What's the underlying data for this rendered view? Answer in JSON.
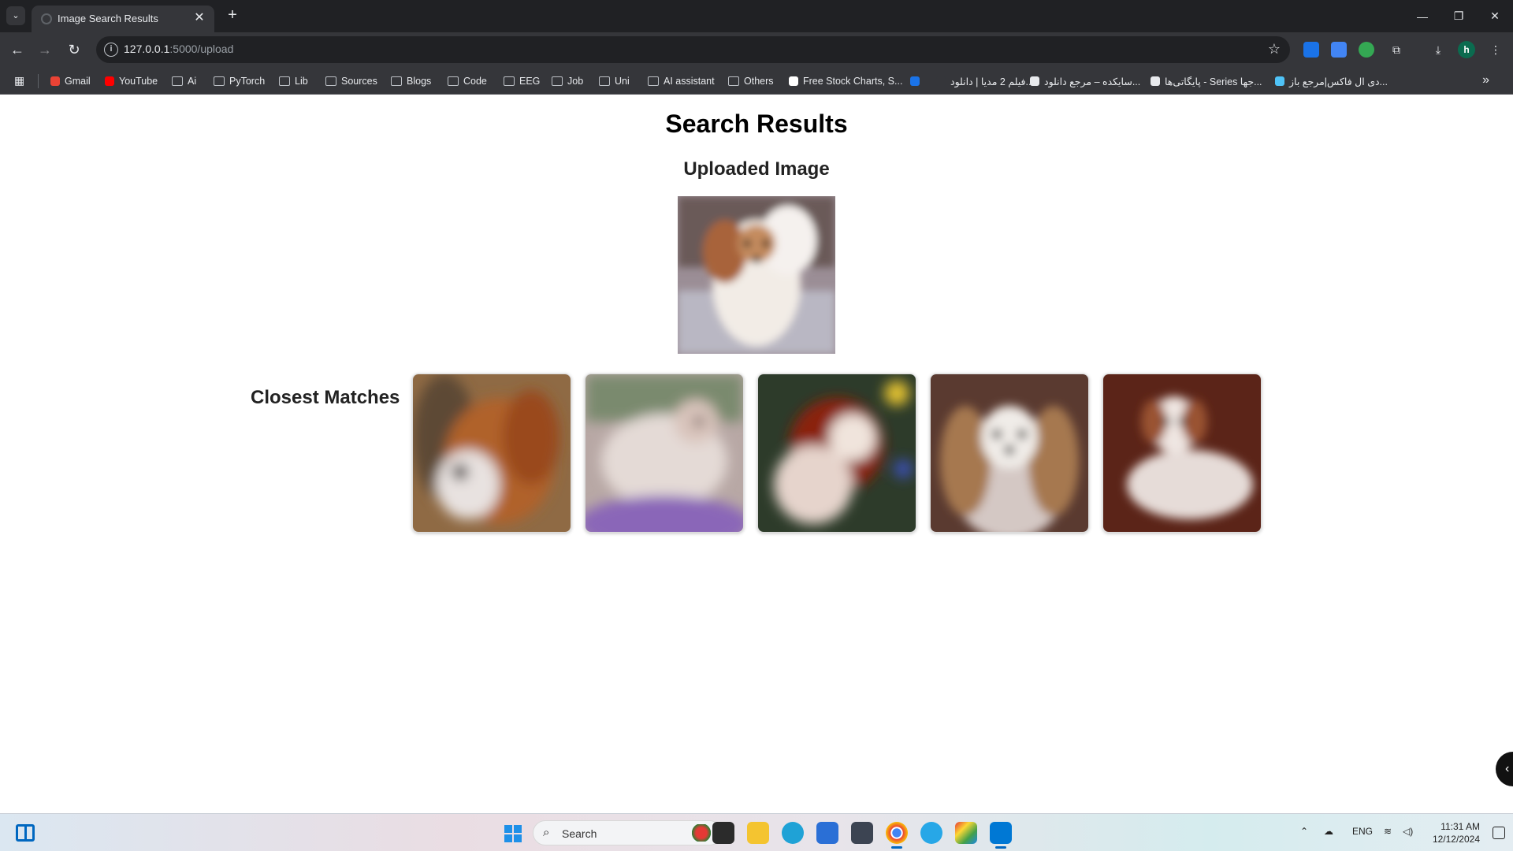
{
  "browser": {
    "tab_title": "Image Search Results",
    "tab_close": "✕",
    "new_tab": "+",
    "window_controls": [
      "—",
      "❐",
      "✕"
    ],
    "url_host": "127.0.0.1",
    "url_path": ":5000/upload",
    "bookmarks": [
      {
        "label": "Gmail",
        "icon": "gmail-icon",
        "color": "#ea4335"
      },
      {
        "label": "YouTube",
        "icon": "youtube-icon",
        "color": "#ff0000"
      },
      {
        "label": "Ai",
        "icon": "folder-icon"
      },
      {
        "label": "PyTorch",
        "icon": "folder-icon"
      },
      {
        "label": "Lib",
        "icon": "folder-icon"
      },
      {
        "label": "Sources",
        "icon": "folder-icon"
      },
      {
        "label": "Blogs",
        "icon": "folder-icon"
      },
      {
        "label": "Code",
        "icon": "folder-icon"
      },
      {
        "label": "EEG",
        "icon": "folder-icon"
      },
      {
        "label": "Job",
        "icon": "folder-icon"
      },
      {
        "label": "Uni",
        "icon": "folder-icon"
      },
      {
        "label": "AI assistant",
        "icon": "folder-icon"
      },
      {
        "label": "Others",
        "icon": "folder-icon"
      },
      {
        "label": "Free Stock Charts, S...",
        "icon": "tradingview-icon",
        "color": "#ffffff"
      },
      {
        "label": "",
        "icon": "site-icon",
        "color": "#1a73e8"
      },
      {
        "label": "فیلم 2 مدیا | دانلود...",
        "icon": "site-icon",
        "color": "#35363a"
      },
      {
        "label": "سایکده – مرجع دانلود...",
        "icon": "s-icon",
        "color": "#e8eaed"
      },
      {
        "label": "پایگاتی‌ها - Series جها...",
        "icon": "w-icon",
        "color": "#e8eaed"
      },
      {
        "label": "دی ال فاکس|مرجع باز...",
        "icon": "d-icon",
        "color": "#4fc3f7"
      }
    ]
  },
  "page": {
    "title": "Search Results",
    "uploaded_heading": "Uploaded Image",
    "matches_heading": "Closest Matches"
  },
  "taskbar": {
    "search_placeholder": "Search",
    "language": "ENG",
    "time": "11:31 AM",
    "date": "12/12/2024"
  }
}
